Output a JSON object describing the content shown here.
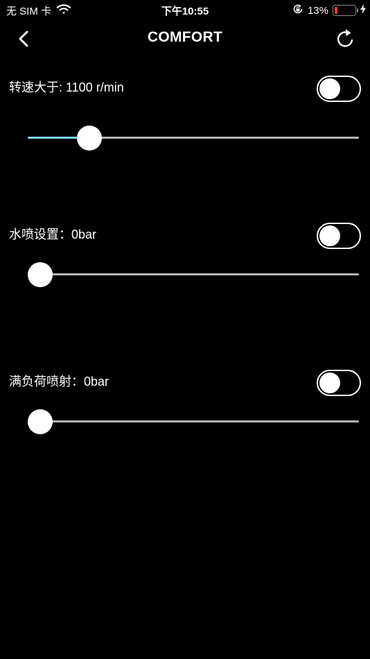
{
  "status_bar": {
    "carrier": "无 SIM 卡",
    "time": "下午10:55",
    "battery_percent": "13%",
    "battery_level": 0.13,
    "battery_color": "#ff3b30"
  },
  "nav": {
    "title": "COMFORT",
    "back_icon": "chevron-left-icon",
    "refresh_icon": "refresh-icon"
  },
  "settings": [
    {
      "label": "转速大于: 1100 r/min",
      "toggle_on": false,
      "slider_fraction": 0.16,
      "accent": "#7fd6e4"
    },
    {
      "label": "水喷设置：0bar",
      "toggle_on": false,
      "slider_fraction": 0.0
    },
    {
      "label": "满负荷喷射：0bar",
      "toggle_on": false,
      "slider_fraction": 0.0
    }
  ]
}
